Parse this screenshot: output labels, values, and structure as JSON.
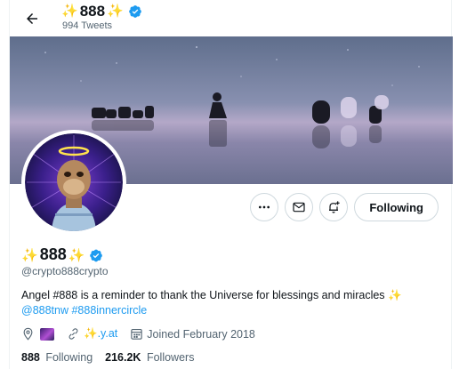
{
  "header": {
    "back_label": "Back",
    "name_prefix": "✨",
    "name_core": "888",
    "name_suffix": "✨",
    "tweet_count": "994 Tweets"
  },
  "actions": {
    "more_icon": "more-horizontal-icon",
    "message_icon": "envelope-icon",
    "notify_icon": "bell-plus-icon",
    "following_label": "Following"
  },
  "profile": {
    "name_prefix": "✨",
    "name_core": "888",
    "name_suffix": "✨",
    "handle": "@crypto888crypto",
    "bio_text": "Angel #888 is a reminder to thank the Universe for blessings and miracles ✨",
    "bio_link_1": "@888tnw",
    "bio_link_2": "#888innercircle",
    "location_icon": "location-pin-icon",
    "link_icon": "link-icon",
    "url": "✨.y.at",
    "calendar_icon": "calendar-icon",
    "joined": "Joined February 2018",
    "following_count": "888",
    "following_label": "Following",
    "followers_count": "216.2K",
    "followers_label": "Followers"
  },
  "colors": {
    "accent": "#1d9bf0",
    "text": "#0f1419",
    "muted": "#536471",
    "border": "#cfd9de"
  }
}
